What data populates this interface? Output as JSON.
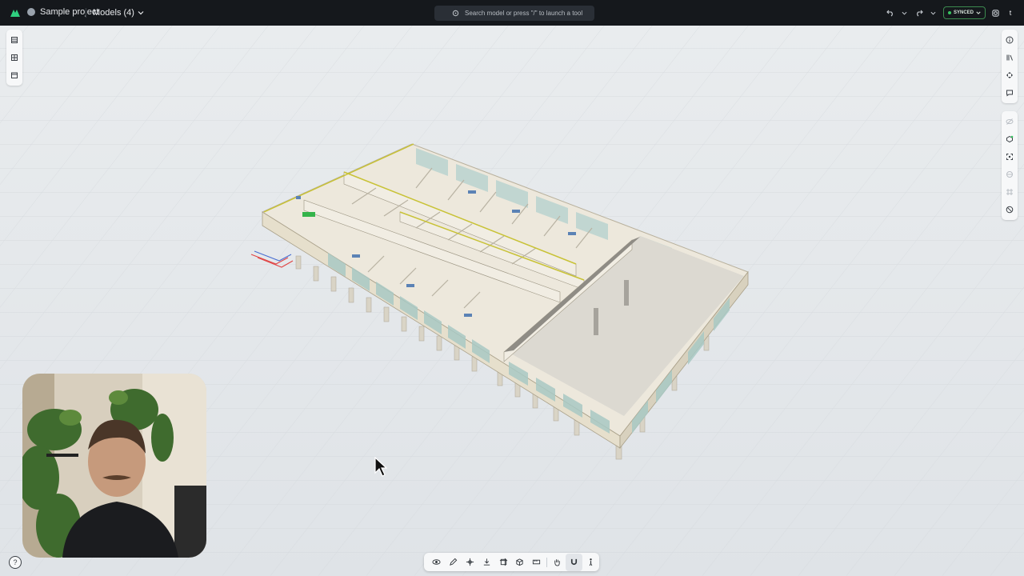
{
  "topbar": {
    "project_name": "Sample project",
    "models_label": "Models (4)",
    "search_placeholder": "Search model or press \"/\" to launch a tool",
    "sync_status": "SYNCED",
    "user_initial": "t"
  },
  "colors": {
    "topbar_bg": "#15181c",
    "viewport_bg": "#e4e7ea",
    "synced_accent": "#37c45f",
    "brand": "#2fcf7f"
  },
  "left_toolbar": {
    "icons": [
      "layers-icon",
      "table-icon",
      "calendar-icon"
    ]
  },
  "right_toolbar": {
    "group1": [
      "info-icon",
      "library-icon",
      "move-axes-icon",
      "comment-icon"
    ],
    "group2": [
      "hide-icon",
      "isolate-icon",
      "fit-view-icon",
      "section-icon",
      "grid-icon",
      "reset-icon"
    ]
  },
  "bottom_toolbar": {
    "tools": [
      "orbit-icon",
      "markup-pen-icon",
      "crosshair-icon",
      "export-icon",
      "section-box-icon",
      "3d-box-icon",
      "measure-icon",
      "hand-icon",
      "magnet-icon",
      "person-icon"
    ],
    "active": "magnet-icon"
  },
  "help_label": "?"
}
